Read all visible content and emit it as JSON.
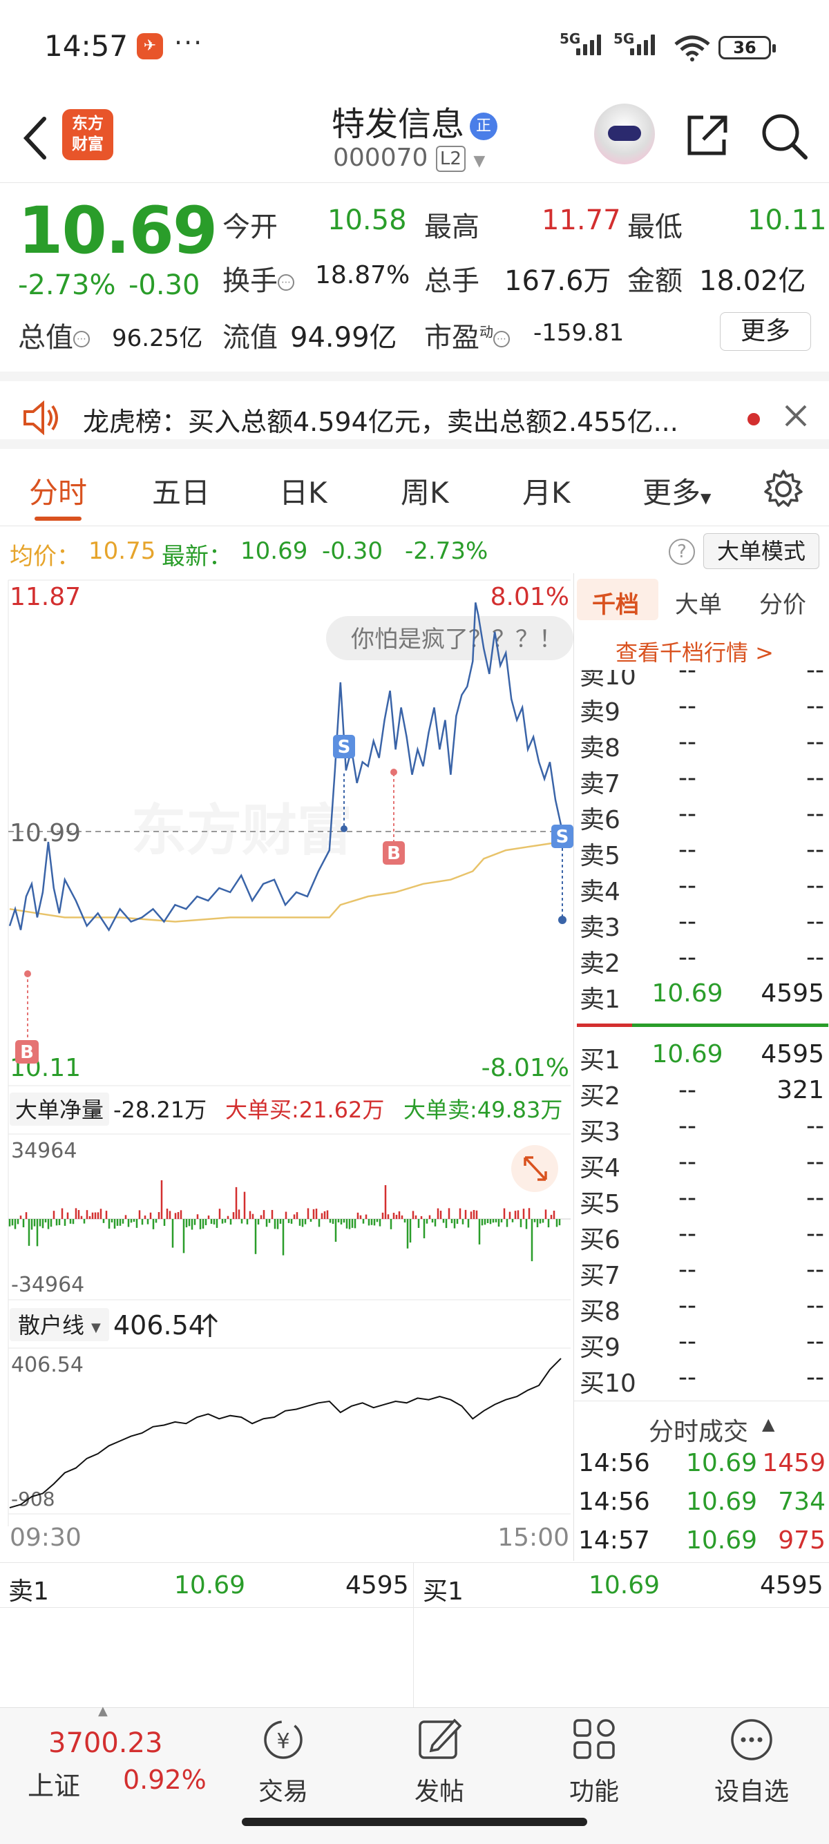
{
  "status": {
    "time": "14:57",
    "app_icon": "✈",
    "dots": "···",
    "net1": "5G",
    "net2": "5G",
    "battery": "36"
  },
  "header": {
    "logo_line1": "东方",
    "logo_line2": "财富",
    "stock_name": "特发信息",
    "zheng_badge": "正",
    "code": "000070",
    "level": "L2"
  },
  "quote": {
    "price": "10.69",
    "change_pct": "-2.73%",
    "change": "-0.30",
    "open_label": "今开",
    "open": "10.58",
    "high_label": "最高",
    "high": "11.77",
    "low_label": "最低",
    "low": "10.11",
    "turnover_label": "换手",
    "turnover": "18.87%",
    "volume_label": "总手",
    "volume": "167.6万",
    "amount_label": "金额",
    "amount": "18.02亿",
    "mktcap_label": "总值",
    "mktcap": "96.25亿",
    "float_label": "流值",
    "float": "94.99亿",
    "pe_label": "市盈",
    "pe_sup": "动",
    "pe": "-159.81",
    "more": "更多"
  },
  "dragon": {
    "text": "龙虎榜：买入总额4.594亿元，卖出总额2.455亿..."
  },
  "tabs": [
    "分时",
    "五日",
    "日K",
    "周K",
    "月K",
    "更多"
  ],
  "avg": {
    "avg_label": "均价：",
    "avg": "10.75",
    "latest_label": "最新：",
    "latest": "10.69",
    "chg": "-0.30",
    "pct": "-2.73%",
    "mode": "大单模式"
  },
  "chart_labels": {
    "top_price": "11.87",
    "top_pct": "8.01%",
    "ref_price": "10.99",
    "bottom_price": "10.11",
    "bottom_pct": "-8.01%",
    "bubble": "你怕是疯了？？？！",
    "watermark": "东方财富",
    "big_net_label": "大单净量",
    "big_net": "-28.21万",
    "big_buy": "大单买:21.62万",
    "big_sell": "大单卖:49.83万",
    "vol_max": "34964",
    "vol_min": "-34964",
    "retail_label": "散户线",
    "retail_val": "406.54",
    "retail_max": "406.54",
    "retail_min": "-908",
    "t_start": "09:30",
    "t_end": "15:00",
    "marker_s": "S",
    "marker_b": "B"
  },
  "right": {
    "tabs": [
      "千档",
      "大单",
      "分价"
    ],
    "link": "查看千档行情 >",
    "sells": [
      {
        "label": "卖10",
        "price": "--",
        "vol": "--"
      },
      {
        "label": "卖9",
        "price": "--",
        "vol": "--"
      },
      {
        "label": "卖8",
        "price": "--",
        "vol": "--"
      },
      {
        "label": "卖7",
        "price": "--",
        "vol": "--"
      },
      {
        "label": "卖6",
        "price": "--",
        "vol": "--"
      },
      {
        "label": "卖5",
        "price": "--",
        "vol": "--"
      },
      {
        "label": "卖4",
        "price": "--",
        "vol": "--"
      },
      {
        "label": "卖3",
        "price": "--",
        "vol": "--"
      },
      {
        "label": "卖2",
        "price": "--",
        "vol": "--"
      },
      {
        "label": "卖1",
        "price": "10.69",
        "vol": "4595"
      }
    ],
    "buys": [
      {
        "label": "买1",
        "price": "10.69",
        "vol": "4595"
      },
      {
        "label": "买2",
        "price": "--",
        "vol": "321"
      },
      {
        "label": "买3",
        "price": "--",
        "vol": "--"
      },
      {
        "label": "买4",
        "price": "--",
        "vol": "--"
      },
      {
        "label": "买5",
        "price": "--",
        "vol": "--"
      },
      {
        "label": "买6",
        "price": "--",
        "vol": "--"
      },
      {
        "label": "买7",
        "price": "--",
        "vol": "--"
      },
      {
        "label": "买8",
        "price": "--",
        "vol": "--"
      },
      {
        "label": "买9",
        "price": "--",
        "vol": "--"
      },
      {
        "label": "买10",
        "price": "--",
        "vol": "--"
      }
    ],
    "trades_title": "分时成交",
    "trades": [
      {
        "time": "14:56",
        "price": "10.69",
        "vol": "1459",
        "side": "red"
      },
      {
        "time": "14:56",
        "price": "10.69",
        "vol": "734",
        "side": "green"
      },
      {
        "time": "14:57",
        "price": "10.69",
        "vol": "975",
        "side": "red"
      }
    ]
  },
  "bottom_quote": {
    "sell_label": "卖1",
    "sell_price": "10.69",
    "sell_vol": "4595",
    "buy_label": "买1",
    "buy_price": "10.69",
    "buy_vol": "4595"
  },
  "navbar": {
    "index_value": "3700.23",
    "index_name": "上证",
    "index_pct": "0.92%",
    "items": [
      "交易",
      "发帖",
      "功能",
      "设自选"
    ]
  },
  "colors": {
    "up": "#d32f2f",
    "down": "#2a9d2a",
    "accent": "#d9521f",
    "price_line": "#3a64a8",
    "avg_line": "#e8c36a"
  }
}
